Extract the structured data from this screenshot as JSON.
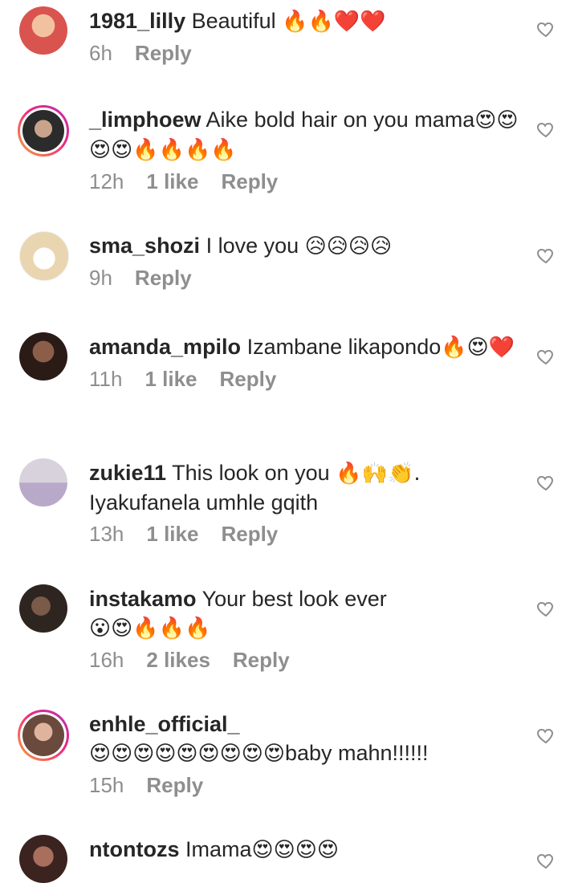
{
  "comments": [
    {
      "username": "1981_lilly",
      "text": " Beautiful ",
      "emoji": "🔥🔥❤️❤️",
      "time": "6h",
      "likes": "",
      "reply": "Reply",
      "avatar_color": "#d9534f",
      "ring": false
    },
    {
      "username": "_limphoew",
      "text": " Aike bold hair on you mama",
      "emoji": "😍😍😍😍🔥🔥🔥🔥",
      "time": "12h",
      "likes": "1 like",
      "reply": "Reply",
      "avatar_color": "#3a3a3a",
      "ring": true
    },
    {
      "username": "sma_shozi",
      "text": " I love you ",
      "emoji": "😥😥😥😥",
      "time": "9h",
      "likes": "",
      "reply": "Reply",
      "avatar_color": "#e9d6b0",
      "ring": false
    },
    {
      "username": "amanda_mpilo",
      "text": " Izambane likapondo",
      "emoji": "🔥😍❤️",
      "time": "11h",
      "likes": "1 like",
      "reply": "Reply",
      "avatar_color": "#5a3b2e",
      "ring": false
    },
    {
      "username": "zukie11",
      "text": " This look on you ",
      "emoji": "🔥🙌👏.",
      "text2": "Iyakufanela umhle gqith",
      "time": "13h",
      "likes": "1 like",
      "reply": "Reply",
      "avatar_color": "#b9a9c9",
      "ring": false
    },
    {
      "username": "instakamo",
      "text": " Your best look ever",
      "emoji": "😮😍🔥🔥🔥",
      "time": "16h",
      "likes": "2 likes",
      "reply": "Reply",
      "avatar_color": "#4a3a32",
      "ring": false
    },
    {
      "username": "enhle_official_",
      "text": "",
      "emoji": "😍😍😍😍😍😍😍😍😍",
      "text2": "baby mahn!!!!!!",
      "time": "15h",
      "likes": "",
      "reply": "Reply",
      "avatar_color": "#c98d7a",
      "ring": true
    },
    {
      "username": "ntontozs",
      "text": " Imama",
      "emoji": "😍😍😍😍",
      "time": "",
      "likes": "",
      "reply": "",
      "avatar_color": "#3b2320",
      "ring": false
    }
  ],
  "colors": {
    "text": "#262626",
    "meta": "#8e8e8e",
    "ring_start": "#f9a23a",
    "ring_end": "#b52fb8"
  },
  "icons": {
    "like": "heart-outline-icon"
  }
}
